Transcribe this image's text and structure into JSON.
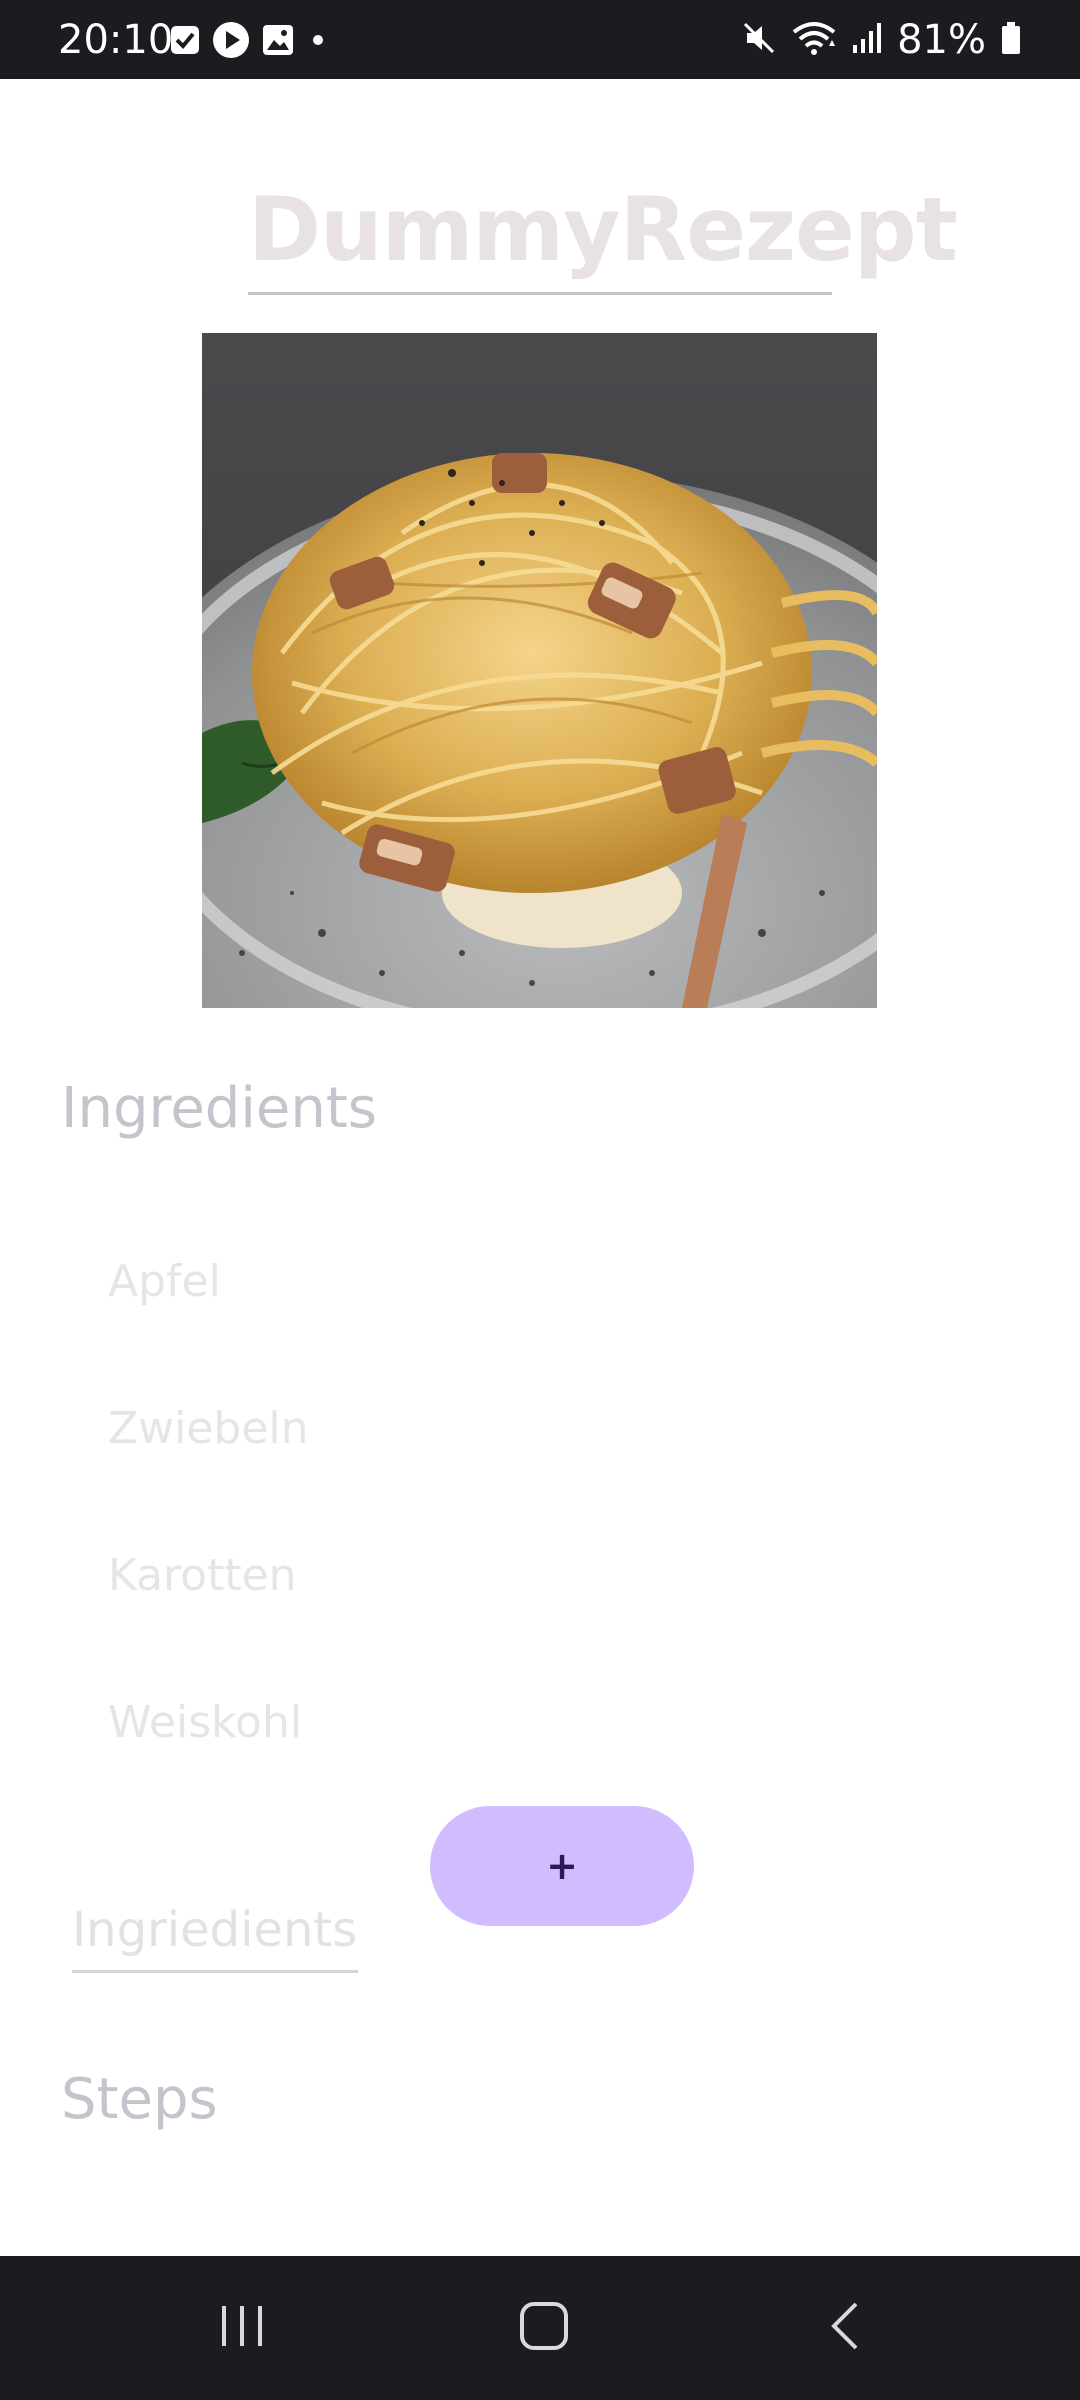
{
  "status_bar": {
    "time": "20:10",
    "battery": "81%",
    "left_icons": [
      "checkbox-notification-icon",
      "play-notification-icon",
      "image-notification-icon",
      "dot-icon"
    ],
    "right_icons": [
      "mute-icon",
      "wifi-icon",
      "signal-icon",
      "battery-icon"
    ]
  },
  "recipe": {
    "title": "DummyRezept",
    "image_subject": "spaghetti carbonara"
  },
  "ingredients": {
    "header": "Ingredients",
    "items": [
      "Apfel",
      "Zwiebeln",
      "Karotten",
      "Weiskohl"
    ],
    "input_placeholder": "Ingriedients",
    "add_button_label": "+"
  },
  "steps": {
    "header": "Steps"
  },
  "nav_bar": {
    "buttons": [
      "recent-apps",
      "home",
      "back"
    ]
  },
  "colors": {
    "status_bar_bg": "#1c1b20",
    "add_button_bg": "#d0bcff",
    "header_text": "#c6c3cc",
    "item_text": "#e6e4e8"
  }
}
